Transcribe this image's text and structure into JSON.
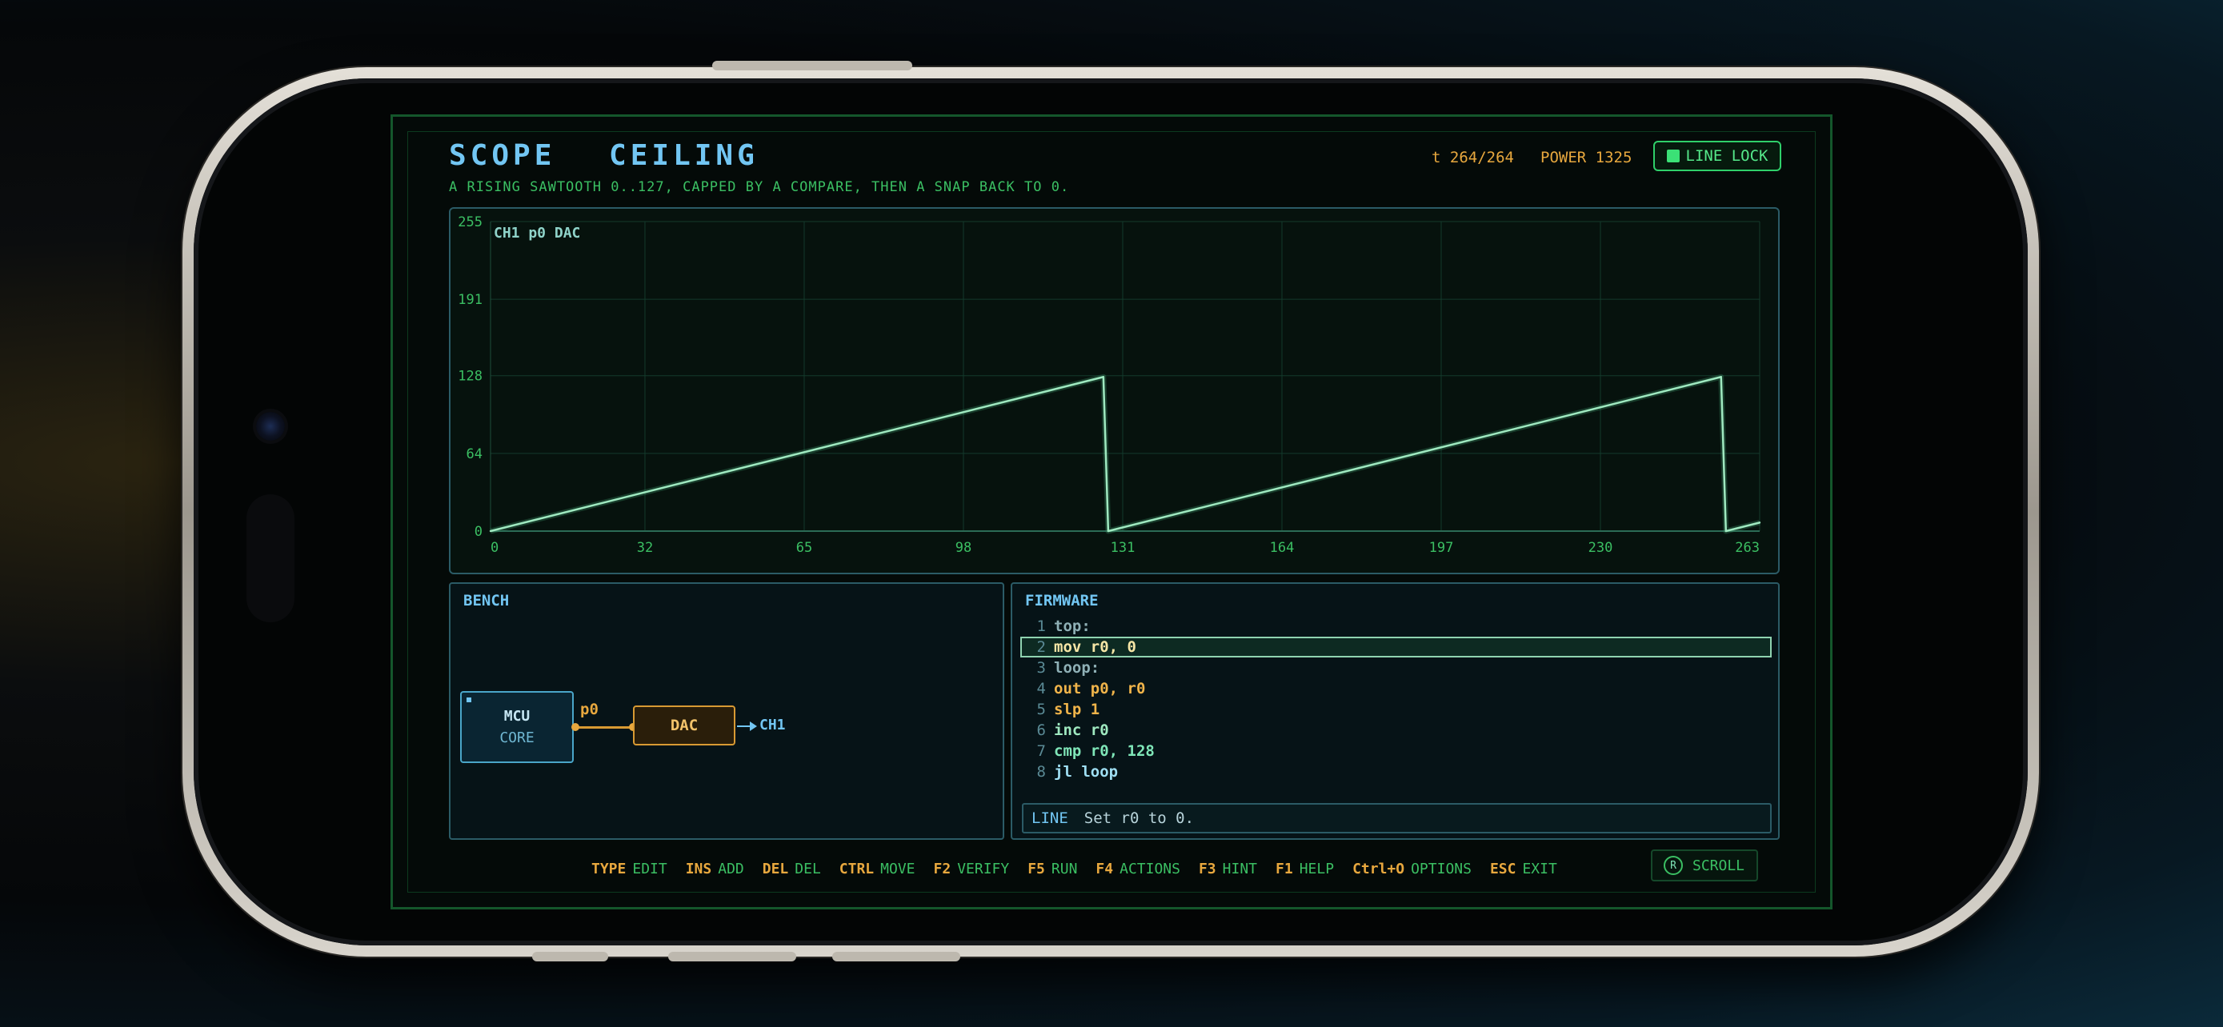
{
  "header": {
    "title": "SCOPE CEILING",
    "subtitle": "A RISING SAWTOOTH 0..127, CAPPED BY A COMPARE, THEN A SNAP BACK TO 0.",
    "time": "t 264/264",
    "power": "POWER 1325",
    "line_lock_label": "LINE LOCK"
  },
  "colors": {
    "accent_blue": "#72c6f3",
    "accent_green": "#3bbf63",
    "accent_orange": "#e8a83e",
    "trace": "#9fe9c0"
  },
  "chart_data": {
    "type": "line",
    "channel_label": "CH1 p0 DAC",
    "xlim": [
      0,
      263
    ],
    "ylim": [
      0,
      255
    ],
    "x_ticks": [
      "0",
      "32",
      "65",
      "98",
      "131",
      "164",
      "197",
      "230",
      "263"
    ],
    "y_ticks": [
      "0",
      "64",
      "128",
      "191",
      "255"
    ],
    "series": [
      {
        "x": [
          0,
          127,
          127.5,
          128,
          255,
          255.5,
          256,
          263
        ],
        "y": [
          0,
          127,
          64,
          0,
          127,
          64,
          0,
          7
        ]
      }
    ],
    "grid": true
  },
  "bench": {
    "title": "BENCH",
    "mcu_line1": "MCU",
    "mcu_line2": "CORE",
    "pin_label": "p0",
    "dac_label": "DAC",
    "output_label": "CH1"
  },
  "firmware": {
    "title": "FIRMWARE",
    "lines": [
      {
        "num": "1",
        "code": "top:"
      },
      {
        "num": "2",
        "code": "mov r0, 0"
      },
      {
        "num": "3",
        "code": "loop:"
      },
      {
        "num": "4",
        "code": "out p0, r0"
      },
      {
        "num": "5",
        "code": "slp 1"
      },
      {
        "num": "6",
        "code": "inc r0"
      },
      {
        "num": "7",
        "code": "cmp r0, 128"
      },
      {
        "num": "8",
        "code": "jl loop"
      }
    ],
    "active_line": 2,
    "hint_key": "LINE",
    "hint_text": "Set r0 to 0."
  },
  "footer": {
    "keys": [
      {
        "key": "TYPE",
        "action": "EDIT"
      },
      {
        "key": "INS",
        "action": "ADD"
      },
      {
        "key": "DEL",
        "action": "DEL"
      },
      {
        "key": "CTRL",
        "action": "MOVE"
      },
      {
        "key": "F2",
        "action": "VERIFY"
      },
      {
        "key": "F5",
        "action": "RUN"
      },
      {
        "key": "F4",
        "action": "ACTIONS"
      },
      {
        "key": "F3",
        "action": "HINT"
      },
      {
        "key": "F1",
        "action": "HELP"
      },
      {
        "key": "Ctrl+O",
        "action": "OPTIONS"
      },
      {
        "key": "ESC",
        "action": "EXIT"
      }
    ],
    "scroll_key": "R",
    "scroll_label": "SCROLL"
  }
}
